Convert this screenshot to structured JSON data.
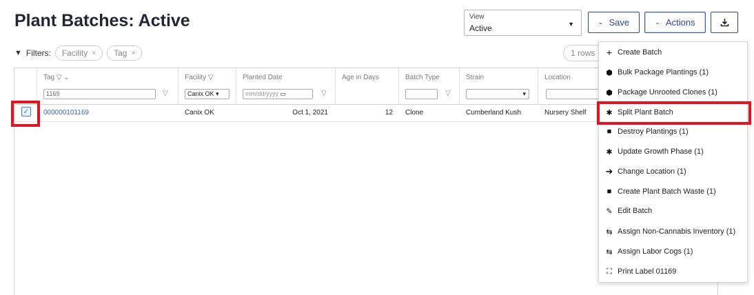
{
  "page": {
    "title": "Plant Batches: Active"
  },
  "view": {
    "label": "View",
    "value": "Active"
  },
  "toolbar": {
    "save_label": "Save",
    "actions_label": "Actions"
  },
  "filters": {
    "label": "Filters:",
    "chips": [
      "Facility",
      "Tag"
    ],
    "rows_count": "1 rows"
  },
  "grid": {
    "columns": [
      "Tag",
      "Facility",
      "Planted Date",
      "Age in Days",
      "Batch Type",
      "Strain",
      "Location"
    ],
    "filter_values": {
      "tag": "1169",
      "facility": "Canix OK",
      "planted_date_placeholder": "mm/dd/yyyy"
    },
    "rows": [
      {
        "tag": "000000101169",
        "facility": "Canix OK",
        "planted_date": "Oct 1, 2021",
        "age_in_days": "12",
        "batch_type": "Clone",
        "strain": "Cumberland Kush",
        "location": "Nursery Shelf",
        "selected": true
      }
    ]
  },
  "actions_menu": {
    "items": [
      {
        "label": "Create Batch",
        "icon": "plus-icon"
      },
      {
        "label": "Bulk Package Plantings (1)",
        "icon": "package-icon"
      },
      {
        "label": "Package Unrooted Clones (1)",
        "icon": "package-icon"
      },
      {
        "label": "Split Plant Batch",
        "icon": "cannabis-leaf-icon"
      },
      {
        "label": "Destroy Plantings (1)",
        "icon": "trash-icon"
      },
      {
        "label": "Update Growth Phase (1)",
        "icon": "cannabis-leaf-icon"
      },
      {
        "label": "Change Location (1)",
        "icon": "arrow-right-icon"
      },
      {
        "label": "Create Plant Batch Waste (1)",
        "icon": "trash-icon"
      },
      {
        "label": "Edit Batch",
        "icon": "edit-icon"
      },
      {
        "label": "Assign Non-Cannabis Inventory (1)",
        "icon": "swap-icon"
      },
      {
        "label": "Assign Labor Cogs (1)",
        "icon": "swap-icon"
      },
      {
        "label": "Print Label 01169",
        "icon": "scan-icon"
      }
    ]
  },
  "colors": {
    "accent": "#2d4a8a",
    "link": "#3a66c4",
    "highlight": "#e3141f"
  }
}
